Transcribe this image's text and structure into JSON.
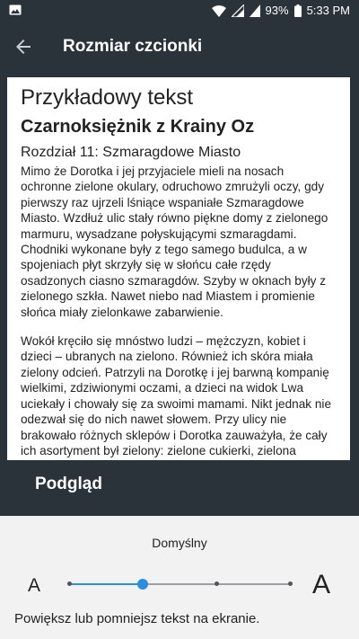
{
  "status_bar": {
    "battery": "93%",
    "time": "5:33 PM",
    "icons": [
      "image-icon",
      "wifi-icon",
      "signal-icon",
      "battery-icon"
    ]
  },
  "toolbar": {
    "back_icon": "arrow-back-icon",
    "title": "Rozmiar czcionki"
  },
  "preview": {
    "heading": "Przykładowy tekst",
    "book_title": "Czarnoksiężnik z Krainy Oz",
    "chapter": "Rozdział 11: Szmaragdowe Miasto",
    "paragraphs": [
      "Mimo że Dorotka i jej przyjaciele mieli na nosach ochronne zielone okulary, odruchowo zmrużyli oczy, gdy pierwszy raz ujrzeli lśniące wspaniałe Szmaragdowe Miasto. Wzdłuż ulic stały równo piękne domy z zielonego marmuru, wysadzane połyskującymi szmaragdami. Chodniki wykonane były z tego samego budulca, a w spojeniach płyt skrzyły się w słońcu całe rzędy osadzonych ciasno szmaragdów. Szyby w oknach były z zielonego szkła. Nawet niebo nad Miastem i promienie słońca miały zielonkawe zabarwienie.",
      "Wokół kręciło się mnóstwo ludzi – mężczyzn, kobiet i dzieci – ubranych na zielono. Również ich skóra miała zielony odcień. Patrzyli na Dorotkę i jej barwną kompanię wielkimi, zdziwionymi oczami, a dzieci na widok Lwa uciekały i chowały się za swoimi mamami. Nikt jednak nie odezwał się do nich nawet słowem. Przy ulicy nie brakowało różnych sklepów i Dorotka zauważyła, że cały ich asortyment był zielony: zielone cukierki, zielona prażona kukurydza, zielone buty, zielone kapelusze, wszelkiego rodzaju zielone ubrania. Przy jednym ze stoisk"
    ]
  },
  "preview_label": "Podgląd",
  "font_size": {
    "current_label": "Domyślny",
    "small_label": "A",
    "large_label": "A",
    "steps": 4,
    "selected_step": 1,
    "accent_color": "#2b8ee0",
    "help": "Powiększ lub pomniejsz tekst na ekranie."
  }
}
